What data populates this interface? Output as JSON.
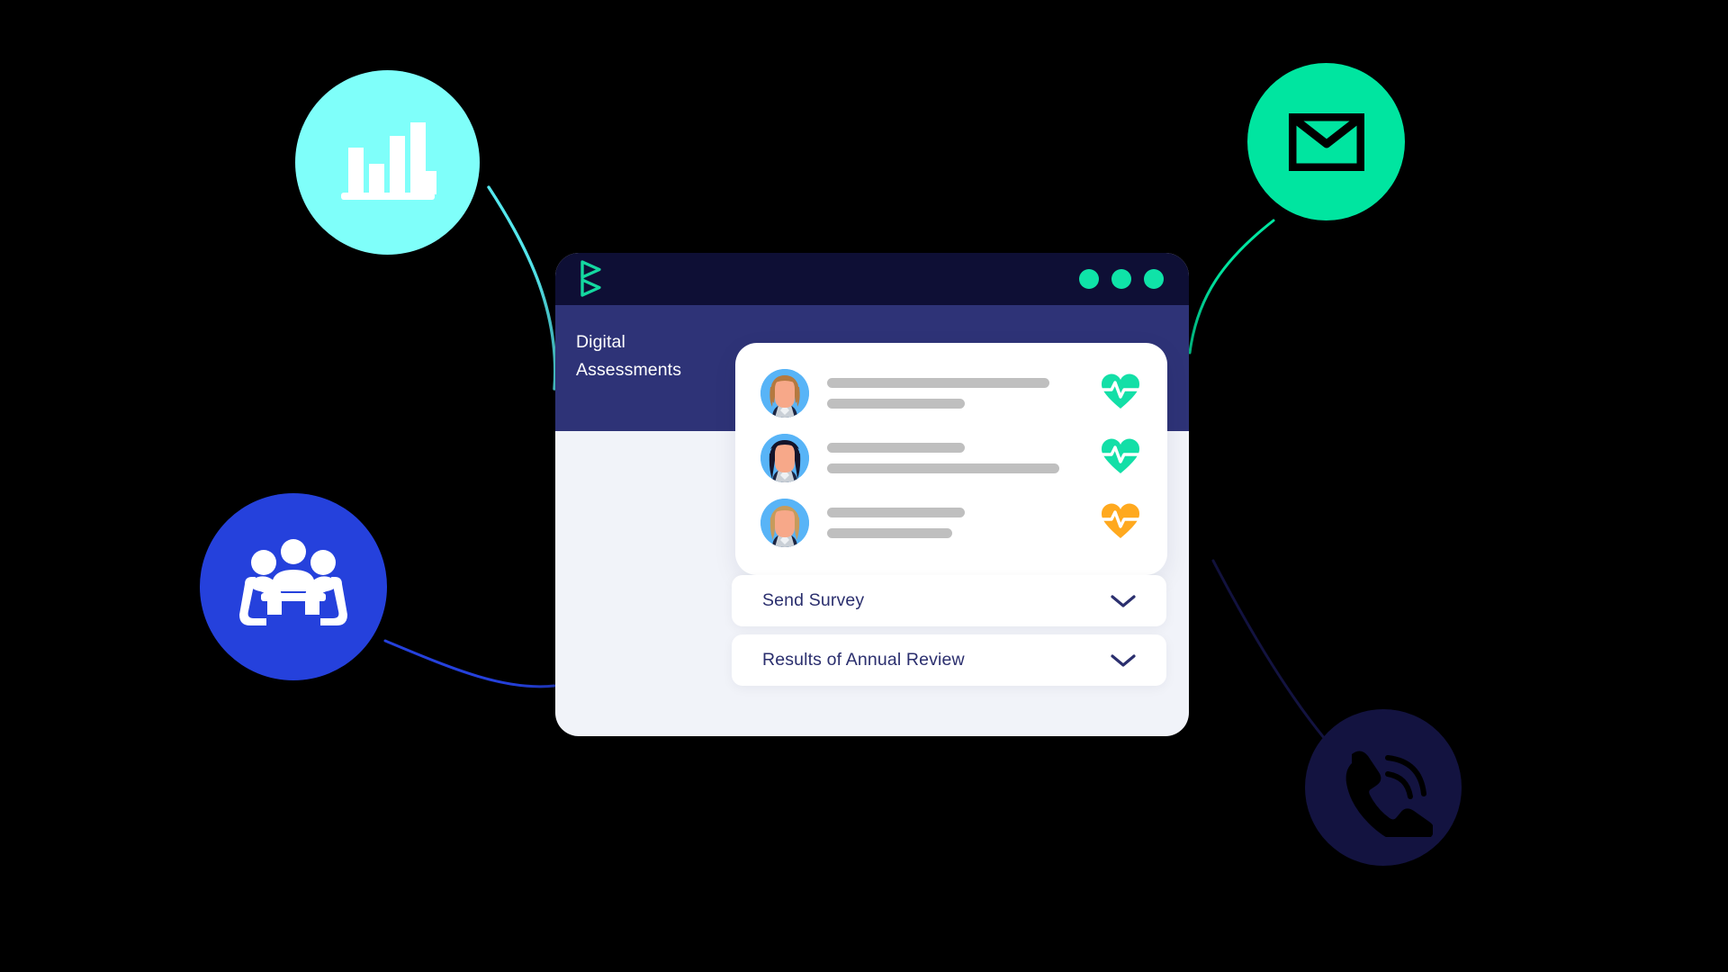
{
  "scene": {
    "background_color": "#000000",
    "description": "Illustration of a browser window for digital assessments surrounded by four floating circular icon badges connected by thin curved lines"
  },
  "badges": [
    {
      "id": "chart",
      "icon": "bar-chart-icon",
      "circle_color": "#7FFFFA",
      "glyph_color": "#FFFFFF",
      "connector_color": "#55E8EE",
      "bars": [
        48,
        35,
        65,
        80,
        25
      ]
    },
    {
      "id": "mail",
      "icon": "envelope-icon",
      "circle_color": "#00E5A0",
      "glyph_color": "#000000",
      "connector_color": "#00E5A0"
    },
    {
      "id": "meeting",
      "icon": "meeting-people-icon",
      "circle_color": "#2541DC",
      "glyph_color": "#FFFFFF",
      "connector_color": "#2541DC"
    },
    {
      "id": "phone",
      "icon": "phone-call-icon",
      "circle_color": "#131340",
      "glyph_color": "#000000",
      "connector_color": "#131340"
    }
  ],
  "window": {
    "titlebar": {
      "background": "#0E0F35",
      "logo": "brand-b-logo",
      "logo_color": "#14D9A0",
      "dots": [
        {
          "color": "#0FE3A8"
        },
        {
          "color": "#0FE3A8"
        },
        {
          "color": "#0FE3A8"
        }
      ]
    },
    "sidebar": {
      "background": "#2E3377",
      "title": "Digital Assessments"
    },
    "content_background": "#F1F3F9",
    "people_card": {
      "background": "#FFFFFF",
      "rows": [
        {
          "avatar": "avatar-woman-brown-hair",
          "hair_color": "#B5793F",
          "skeleton_widths": [
            "87%",
            "54%"
          ],
          "status_icon": "heart-pulse-icon",
          "status_color": "#13DFA7",
          "status": "good"
        },
        {
          "avatar": "avatar-woman-black-hair",
          "hair_color": "#14142A",
          "skeleton_widths": [
            "54%",
            "91%"
          ],
          "status_icon": "heart-pulse-icon",
          "status_color": "#13DFA7",
          "status": "good"
        },
        {
          "avatar": "avatar-woman-blonde-hair",
          "hair_color": "#C79B5B",
          "skeleton_widths": [
            "54%",
            "49%"
          ],
          "status_icon": "heart-pulse-icon",
          "status_color": "#FFA91F",
          "status": "warning"
        }
      ],
      "skeleton_color": "#BFBFBF"
    },
    "accordion": {
      "text_color": "#2B2F6E",
      "chevron_icon": "chevron-down-icon",
      "items": [
        {
          "label": "Send Survey",
          "expanded": false
        },
        {
          "label": "Results of Annual Review",
          "expanded": false
        }
      ]
    }
  }
}
